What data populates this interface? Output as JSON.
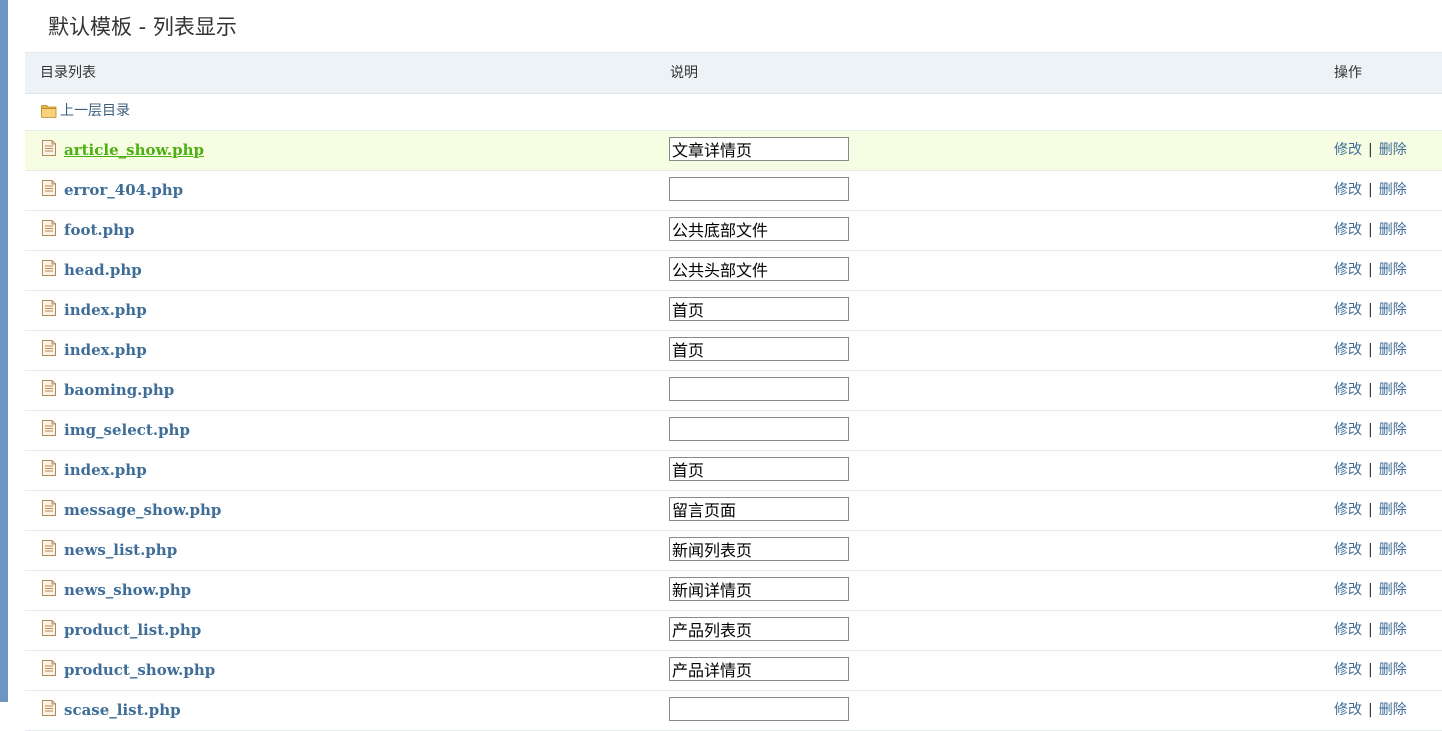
{
  "page": {
    "title": "默认模板 - 列表显示"
  },
  "table": {
    "headers": {
      "dir": "目录列表",
      "desc": "说明",
      "op": "操作"
    },
    "up_dir": "上一层目录",
    "edit_label": "修改",
    "delete_label": "删除",
    "separator": "|",
    "rows": [
      {
        "file": "article_show.php",
        "desc": "文章详情页",
        "highlight": true
      },
      {
        "file": "error_404.php",
        "desc": ""
      },
      {
        "file": "foot.php",
        "desc": "公共底部文件"
      },
      {
        "file": "head.php",
        "desc": "公共头部文件"
      },
      {
        "file": "index.php",
        "desc": "首页"
      },
      {
        "file": "index.php",
        "desc": "首页"
      },
      {
        "file": "baoming.php",
        "desc": ""
      },
      {
        "file": "img_select.php",
        "desc": ""
      },
      {
        "file": "index.php",
        "desc": "首页"
      },
      {
        "file": "message_show.php",
        "desc": "留言页面"
      },
      {
        "file": "news_list.php",
        "desc": "新闻列表页"
      },
      {
        "file": "news_show.php",
        "desc": "新闻详情页"
      },
      {
        "file": "product_list.php",
        "desc": "产品列表页"
      },
      {
        "file": "product_show.php",
        "desc": "产品详情页"
      },
      {
        "file": "scase_list.php",
        "desc": ""
      }
    ]
  },
  "colors": {
    "accent_bar": "#6d96c5",
    "link": "#3e6d98",
    "active_link": "#4caf12",
    "highlight_row": "#f7fde3",
    "header_bg": "#edf2f7"
  },
  "icons": {
    "folder": "folder-icon",
    "file": "file-icon"
  }
}
